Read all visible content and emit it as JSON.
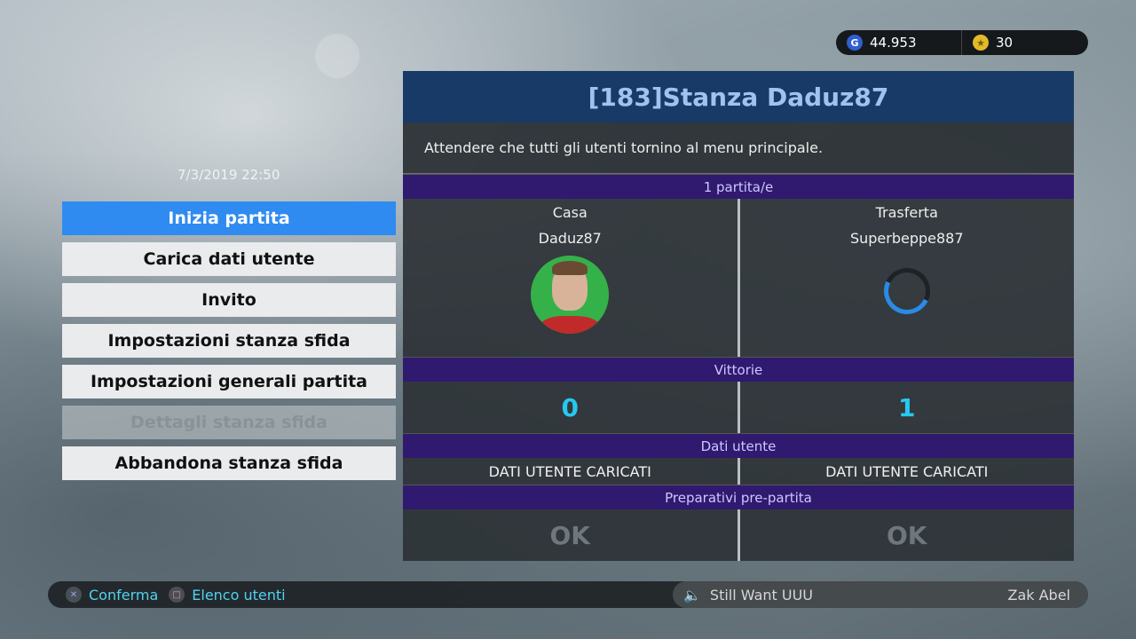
{
  "currency": {
    "gp_icon": "G",
    "gp": "44.953",
    "coins": "30"
  },
  "date": "7/3/2019 22:50",
  "menu": [
    {
      "label": "Inizia partita"
    },
    {
      "label": "Carica dati utente"
    },
    {
      "label": "Invito"
    },
    {
      "label": "Impostazioni stanza sfida"
    },
    {
      "label": "Impostazioni generali partita"
    },
    {
      "label": "Dettagli stanza sfida"
    },
    {
      "label": "Abbandona stanza sfida"
    }
  ],
  "panel": {
    "title": "[183]Stanza Daduz87",
    "message": "Attendere che tutti gli utenti tornino al menu principale.",
    "matches": "1 partita/e",
    "home": {
      "side": "Casa",
      "name": "Daduz87"
    },
    "away": {
      "side": "Trasferta",
      "name": "Superbeppe887"
    },
    "wins_label": "Vittorie",
    "wins": {
      "home": "0",
      "away": "1"
    },
    "userdata_label": "Dati utente",
    "userdata": {
      "home": "DATI UTENTE CARICATI",
      "away": "DATI UTENTE CARICATI"
    },
    "prep_label": "Preparativi pre-partita",
    "prep": {
      "home": "OK",
      "away": "OK"
    }
  },
  "footer": {
    "confirm": "Conferma",
    "user_list": "Elenco utenti",
    "track": "Still Want UUU",
    "artist": "Zak Abel"
  },
  "icons": {
    "gp": "gp-coin-icon",
    "coin": "star-coin-icon",
    "cross": "cross-button-icon",
    "square": "square-button-icon",
    "speaker": "speaker-icon",
    "spinner": "loading-spinner-icon"
  },
  "colors": {
    "accent_blue": "#2f8bf0",
    "title_bg": "#173a66",
    "section_purple": "#2f1a70",
    "wins_cyan": "#28c7f0"
  }
}
